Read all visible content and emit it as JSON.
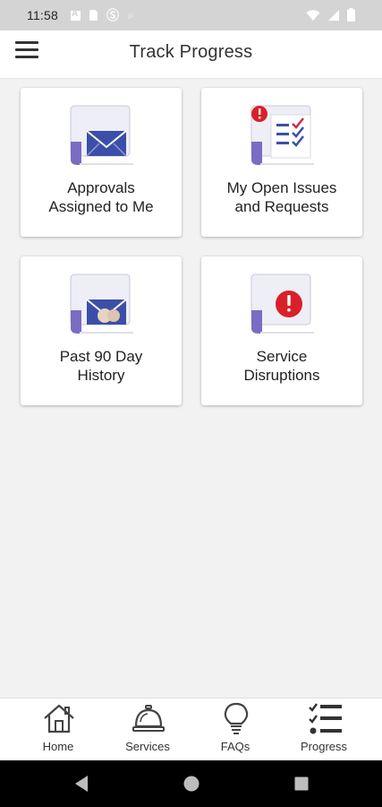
{
  "status_bar": {
    "time": "11:58",
    "left_icons": [
      "a-box-icon",
      "sd-card-icon",
      "s-icon",
      "wifi-icon"
    ],
    "right_icons": [
      "wifi-icon",
      "signal-icon",
      "battery-icon"
    ]
  },
  "app_bar": {
    "title": "Track Progress",
    "menu_icon": "hamburger-menu-icon"
  },
  "tiles": [
    {
      "label": "Approvals\nAssigned to Me",
      "icon": "envelope-icon"
    },
    {
      "label": "My Open Issues\nand Requests",
      "icon": "checklist-alert-icon"
    },
    {
      "label": "Past 90 Day\nHistory",
      "icon": "envelope-history-icon"
    },
    {
      "label": "Service\nDisruptions",
      "icon": "alert-icon"
    }
  ],
  "bottom_nav": [
    {
      "label": "Home",
      "icon": "home-icon"
    },
    {
      "label": "Services",
      "icon": "service-bell-icon"
    },
    {
      "label": "FAQs",
      "icon": "lightbulb-icon"
    },
    {
      "label": "Progress",
      "icon": "checklist-icon"
    }
  ],
  "system_nav": [
    "back-icon",
    "home-circle-icon",
    "recents-icon"
  ],
  "colors": {
    "tile_icon_blue": "#3b4fa8",
    "tile_icon_purple": "#6a5bb8",
    "alert_red": "#d9202a",
    "check_red": "#c9304a",
    "background": "#f2f2f2"
  }
}
